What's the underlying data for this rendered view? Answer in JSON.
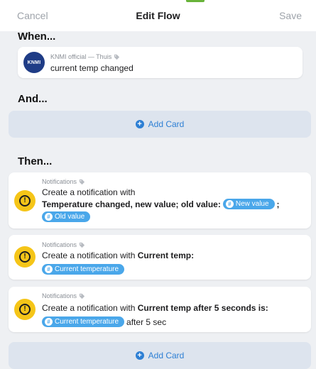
{
  "header": {
    "cancel": "Cancel",
    "title": "Edit Flow",
    "save": "Save"
  },
  "sections": {
    "when": "When...",
    "and": "And...",
    "then": "Then..."
  },
  "when_card": {
    "meta": "KNMI official — Thuis",
    "text": "current temp changed",
    "logo_text": "KNMI"
  },
  "add_card_label": "Add Card",
  "then_cards": [
    {
      "meta": "Notifications",
      "line1": "Create a notification with",
      "line2_bold": "Temperature changed, new value;  old value:",
      "token1": "New value",
      "semicolon": ";",
      "token2": "Old value"
    },
    {
      "meta": "Notifications",
      "line1_plain": "Create a notification with ",
      "line1_bold": "Current temp:",
      "token": "Current temperature"
    },
    {
      "meta": "Notifications",
      "line1_plain": "Create a notification with ",
      "line1_bold": "Current temp after 5 seconds is:",
      "token": "Current temperature",
      "after": "after 5 sec"
    }
  ]
}
